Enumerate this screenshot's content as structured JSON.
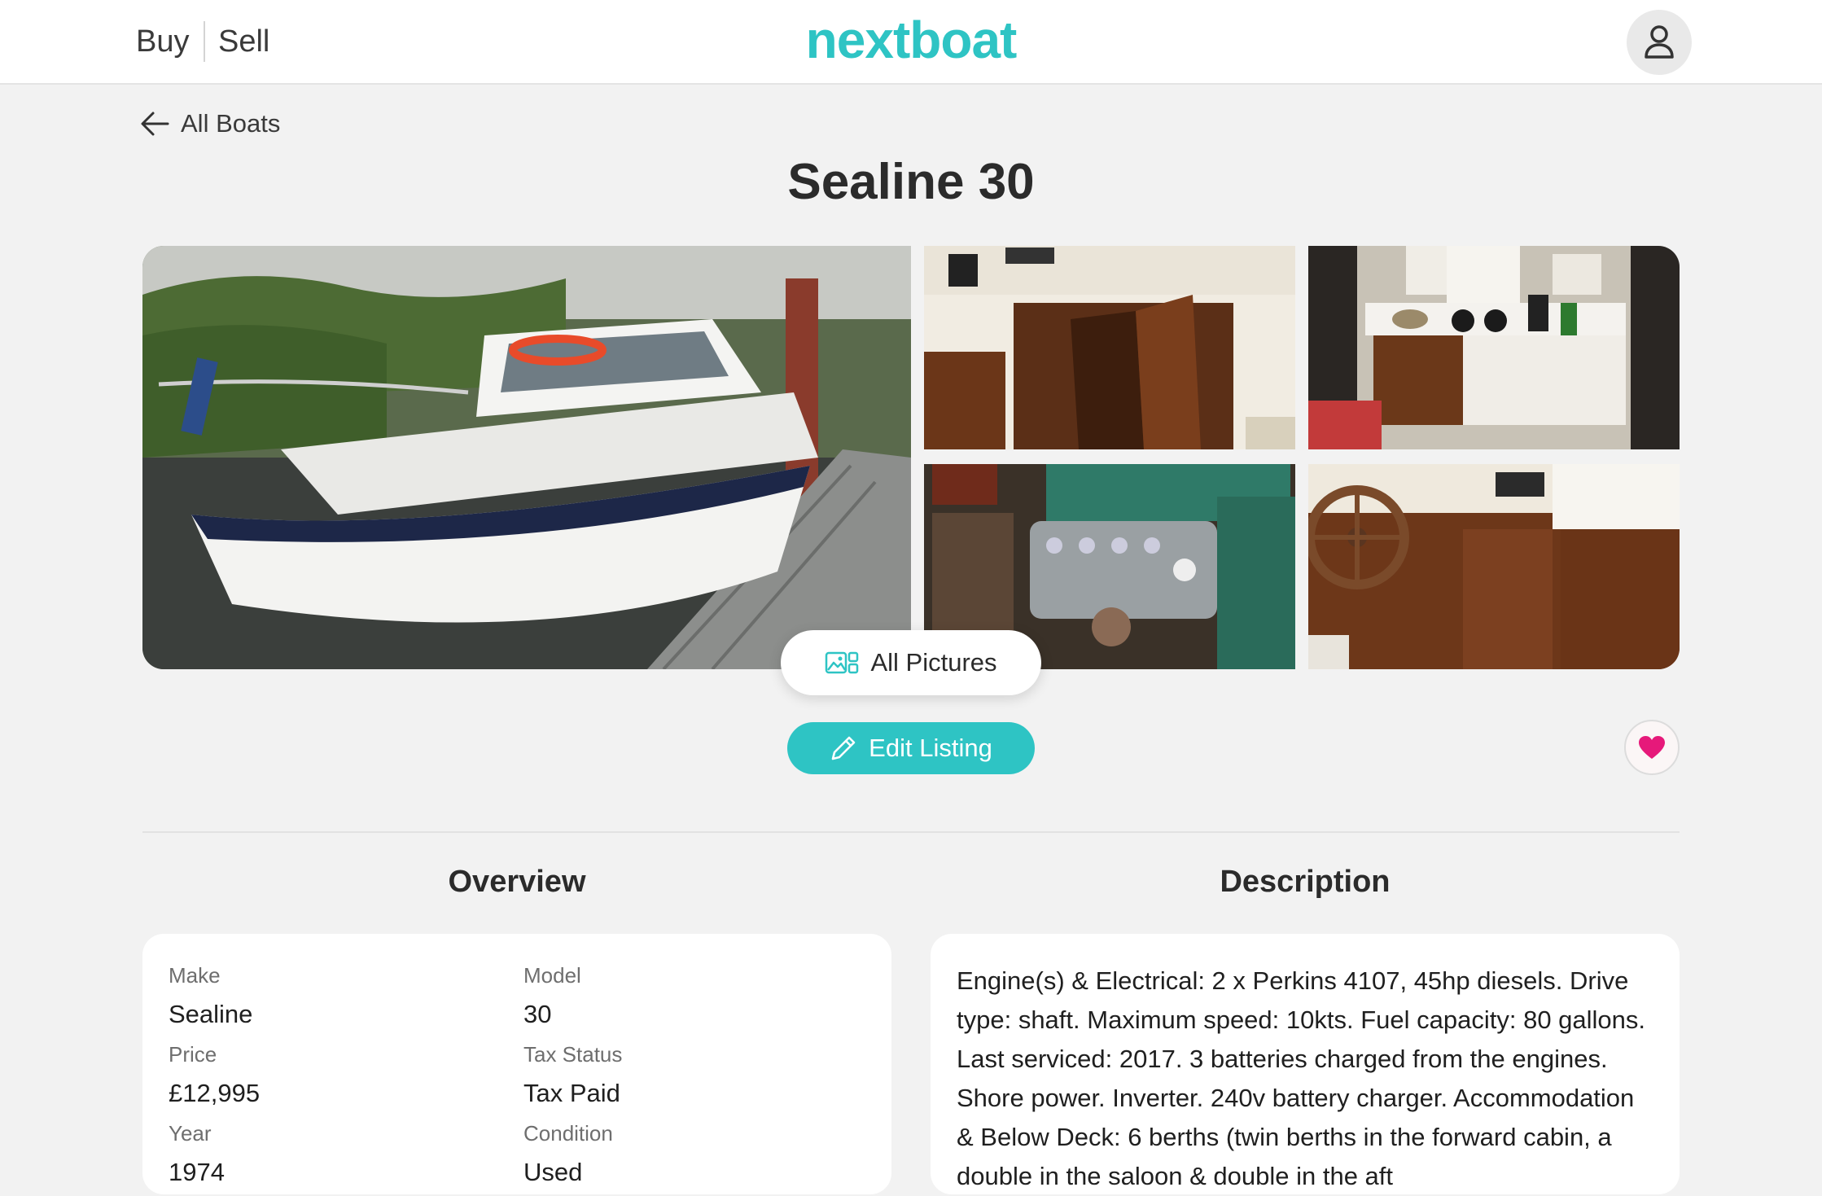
{
  "header": {
    "nav_buy": "Buy",
    "nav_sell": "Sell",
    "logo": "nextboat",
    "user_icon": "user-icon"
  },
  "back_link": {
    "label": "All Boats",
    "icon": "arrow-left-icon"
  },
  "listing": {
    "title": "Sealine 30"
  },
  "gallery": {
    "photos": [
      "boat-exterior-photo",
      "helm-interior-photo",
      "galley-photo",
      "engine-photo",
      "steering-wheel-photo"
    ],
    "all_pictures_label": "All Pictures",
    "all_pictures_icon": "gallery-icon"
  },
  "actions": {
    "edit_label": "Edit Listing",
    "edit_icon": "pencil-icon",
    "favorite_icon": "heart-icon"
  },
  "overview": {
    "heading": "Overview",
    "fields": [
      {
        "label": "Make",
        "value": "Sealine"
      },
      {
        "label": "Model",
        "value": "30"
      },
      {
        "label": "Price",
        "value": "£12,995"
      },
      {
        "label": "Tax Status",
        "value": "Tax Paid"
      },
      {
        "label": "Year",
        "value": "1974"
      },
      {
        "label": "Condition",
        "value": "Used"
      }
    ]
  },
  "description": {
    "heading": "Description",
    "text": "Engine(s) & Electrical: 2 x Perkins 4107, 45hp diesels. Drive type: shaft. Maximum speed: 10kts. Fuel capacity: 80 gallons. Last serviced: 2017. 3 batteries charged from the engines. Shore power. Inverter. 240v battery charger. Accommodation & Below Deck: 6 berths (twin berths in the forward cabin, a double in the saloon & double in the aft"
  },
  "colors": {
    "brand": "#2ec4c4",
    "heart": "#e6197a",
    "background": "#f2f2f2"
  }
}
